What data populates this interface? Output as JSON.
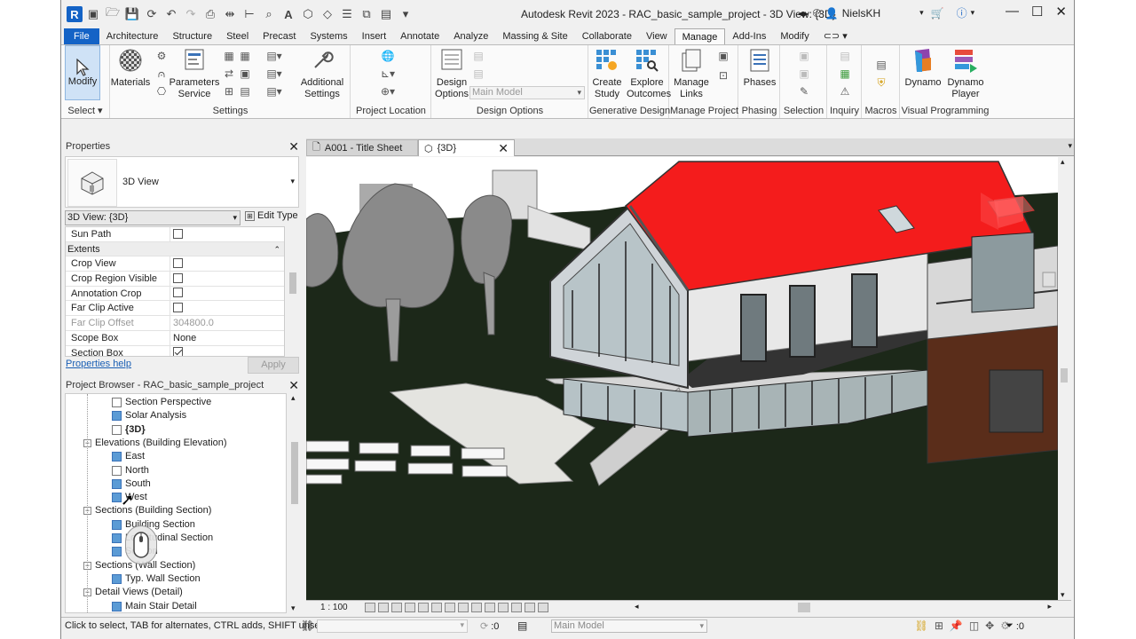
{
  "app": {
    "title": "Autodesk Revit 2023 - RAC_basic_sample_project - 3D View: {3D}",
    "user": "NielsKH",
    "logo_letter": "R",
    "accent": "#1463c6"
  },
  "ribbon": {
    "tabs": [
      "File",
      "Architecture",
      "Structure",
      "Steel",
      "Precast",
      "Systems",
      "Insert",
      "Annotate",
      "Analyze",
      "Massing & Site",
      "Collaborate",
      "View",
      "Manage",
      "Add-Ins",
      "Modify"
    ],
    "active_tab": "Manage",
    "panels": {
      "select": {
        "label": "Select",
        "modify": "Modify"
      },
      "settings": {
        "label": "Settings",
        "materials": "Materials",
        "parameters_service": "Parameters Service",
        "additional_settings": "Additional Settings"
      },
      "project_location": {
        "label": "Project Location"
      },
      "design_options": {
        "label": "Design Options",
        "design_options_btn": "Design Options",
        "main_model": "Main Model"
      },
      "generative_design": {
        "label": "Generative Design",
        "create_study": "Create Study",
        "explore_outcomes": "Explore Outcomes"
      },
      "manage_project": {
        "label": "Manage Project",
        "manage_links": "Manage Links"
      },
      "phasing": {
        "label": "Phasing",
        "phases": "Phases"
      },
      "selection": {
        "label": "Selection"
      },
      "inquiry": {
        "label": "Inquiry"
      },
      "macros": {
        "label": "Macros"
      },
      "visual_programming": {
        "label": "Visual Programming",
        "dynamo": "Dynamo",
        "dynamo_player": "Dynamo Player"
      }
    }
  },
  "properties": {
    "title": "Properties",
    "type_name": "3D View",
    "view_selector": "3D View: {3D}",
    "edit_type": "Edit Type",
    "rows": [
      {
        "name": "Sun Path",
        "value": "",
        "checkbox": false
      },
      {
        "group": "Extents"
      },
      {
        "name": "Crop View",
        "value": "",
        "checkbox": false
      },
      {
        "name": "Crop Region Visible",
        "value": "",
        "checkbox": false
      },
      {
        "name": "Annotation Crop",
        "value": "",
        "checkbox": false
      },
      {
        "name": "Far Clip Active",
        "value": "",
        "checkbox": false
      },
      {
        "name": "Far Clip Offset",
        "value": "304800.0",
        "dim": true
      },
      {
        "name": "Scope Box",
        "value": "None"
      },
      {
        "name": "Section Box",
        "value": "",
        "checkbox": true
      }
    ],
    "help": "Properties help",
    "apply": "Apply"
  },
  "project_browser": {
    "title": "Project Browser - RAC_basic_sample_project",
    "items": [
      {
        "label": "Section Perspective",
        "level": 2,
        "icon": "plain"
      },
      {
        "label": "Solar Analysis",
        "level": 2,
        "icon": "view"
      },
      {
        "label": "{3D}",
        "level": 2,
        "icon": "plain",
        "bold": true
      },
      {
        "label": "Elevations (Building Elevation)",
        "level": 1,
        "expander": "−"
      },
      {
        "label": "East",
        "level": 2,
        "icon": "view"
      },
      {
        "label": "North",
        "level": 2,
        "icon": "plain"
      },
      {
        "label": "South",
        "level": 2,
        "icon": "view"
      },
      {
        "label": "West",
        "level": 2,
        "icon": "view"
      },
      {
        "label": "Sections (Building Section)",
        "level": 1,
        "expander": "−"
      },
      {
        "label": "Building Section",
        "level": 2,
        "icon": "view"
      },
      {
        "label": "Longitudinal Section",
        "level": 2,
        "icon": "view"
      },
      {
        "label": "Section",
        "level": 2,
        "icon": "view"
      },
      {
        "label": "Sections (Wall Section)",
        "level": 1,
        "expander": "−"
      },
      {
        "label": "Typ. Wall Section",
        "level": 2,
        "icon": "view"
      },
      {
        "label": "Detail Views (Detail)",
        "level": 1,
        "expander": "−"
      },
      {
        "label": "Main Stair Detail",
        "level": 2,
        "icon": "view"
      }
    ]
  },
  "doc_tabs": [
    {
      "label": "A001 - Title Sheet",
      "active": false
    },
    {
      "label": "{3D}",
      "active": true
    }
  ],
  "view_control": {
    "scale": "1 : 100"
  },
  "status": {
    "text": "Click to select, TAB for alternates, CTRL adds, SHIFT unsel",
    "worksharing_count": ":0",
    "design_option": "Main Model",
    "filter_count": ":0"
  },
  "colors": {
    "roof": "#f41c1c",
    "ground": "#1d2a1a",
    "wall": "#e6e6e6",
    "tree": "#8a8a8a"
  }
}
